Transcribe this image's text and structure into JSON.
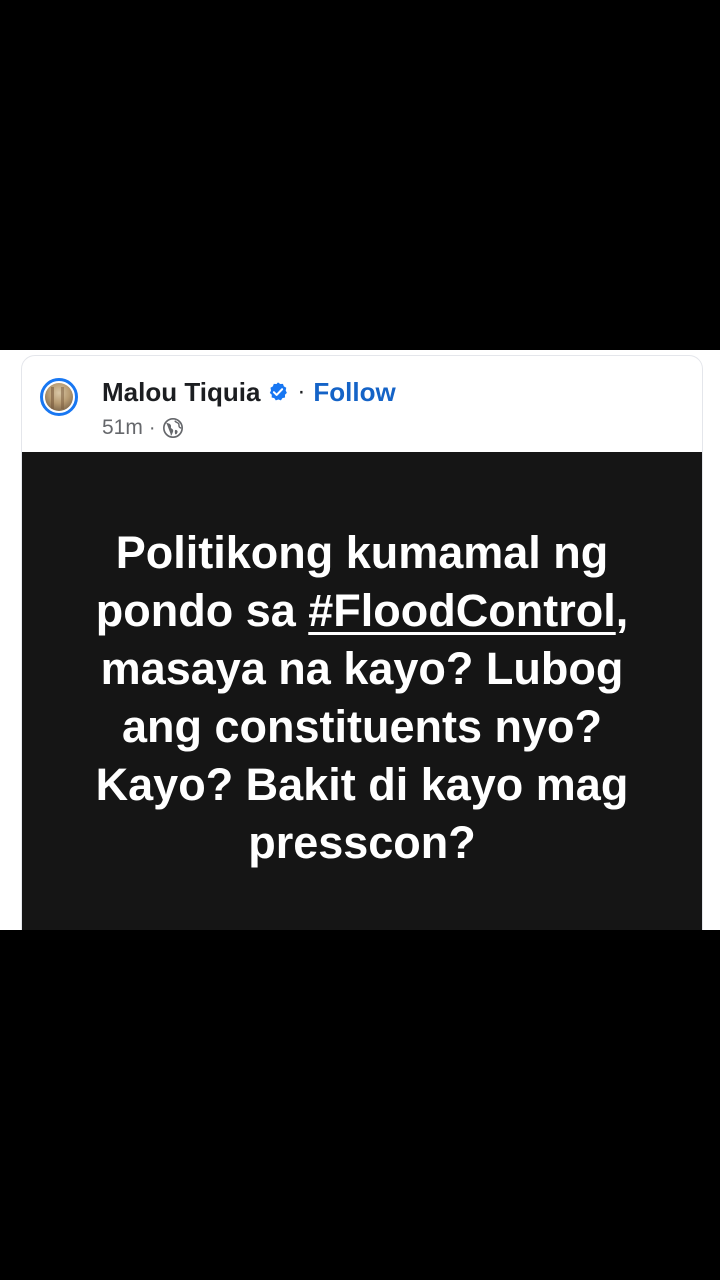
{
  "post": {
    "author": "Malou Tiquia",
    "follow_label": "Follow",
    "separator": "·",
    "time": "51m",
    "verified": true,
    "accent_color": "#1877f2",
    "icons": {
      "avatar": "profile-avatar",
      "verified": "verified-badge-icon",
      "audience": "globe-icon"
    },
    "image_text": {
      "line1": "Politikong kumamal ng",
      "line2_prefix": "pondo sa ",
      "line2_hashtag": "#FloodControl",
      "line2_suffix": ",",
      "line3": "masaya na kayo? Lubog",
      "line4": "ang constituents nyo?",
      "line5": "Kayo? Bakit di kayo mag",
      "line6": "presscon?"
    }
  }
}
